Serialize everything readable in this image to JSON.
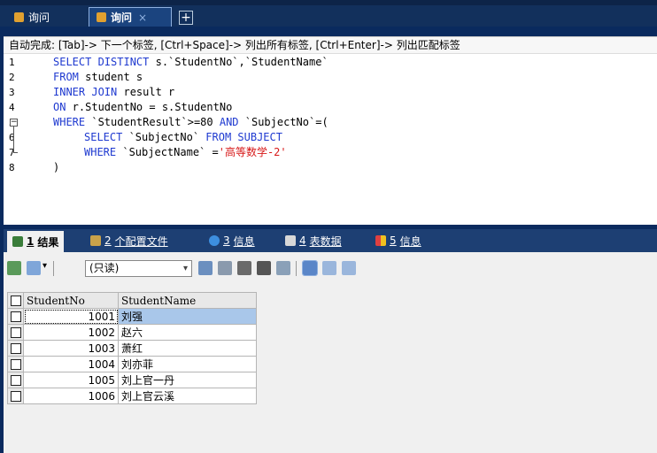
{
  "tabs": [
    {
      "label": "询问",
      "active": false
    },
    {
      "label": "询问",
      "active": true,
      "close": "×"
    }
  ],
  "add_tab_label": "+",
  "editor": {
    "hint": "自动完成: [Tab]-> 下一个标签, [Ctrl+Space]-> 列出所有标签, [Ctrl+Enter]-> 列出匹配标签",
    "line_numbers": [
      "1",
      "2",
      "3",
      "4",
      "5",
      "6",
      "7",
      "8"
    ]
  },
  "sql": {
    "l1_kw": "SELECT DISTINCT",
    "l1_rest": " s.`StudentNo`,`StudentName`",
    "l2_kw": "FROM",
    "l2_rest": " student s",
    "l3_kw": "INNER JOIN",
    "l3_rest": " result r",
    "l4_kw": "ON",
    "l4_rest": " r.StudentNo = s.StudentNo",
    "l5_kw": "WHERE",
    "l5_mid": " `StudentResult`>=80 ",
    "l5_and": "AND",
    "l5_end": " `SubjectNo`=(",
    "l6_kw": "SELECT",
    "l6_mid": " `SubjectNo` ",
    "l6_from": "FROM SUBJECT",
    "l7_kw": "WHERE",
    "l7_mid": " `SubjectName` =",
    "l7_str": "'高等数学-2'",
    "l8": ")"
  },
  "result_tabs": [
    {
      "num": "1",
      "label": "结果"
    },
    {
      "num": "2",
      "label": "个配置文件"
    },
    {
      "num": "3",
      "label": "信息"
    },
    {
      "num": "4",
      "label": "表数据"
    },
    {
      "num": "5",
      "label": "信息"
    }
  ],
  "toolbar": {
    "readonly": "(只读)"
  },
  "grid": {
    "columns": [
      "StudentNo",
      "StudentName"
    ],
    "rows": [
      {
        "no": "1001",
        "name": "刘强"
      },
      {
        "no": "1002",
        "name": "赵六"
      },
      {
        "no": "1003",
        "name": "萧红"
      },
      {
        "no": "1004",
        "name": "刘亦菲"
      },
      {
        "no": "1005",
        "name": "刘上官一丹"
      },
      {
        "no": "1006",
        "name": "刘上官云溪"
      }
    ]
  },
  "colors": {
    "keyword": "#1f3ad0",
    "string": "#d71919",
    "selection": "#a9c7ea"
  }
}
